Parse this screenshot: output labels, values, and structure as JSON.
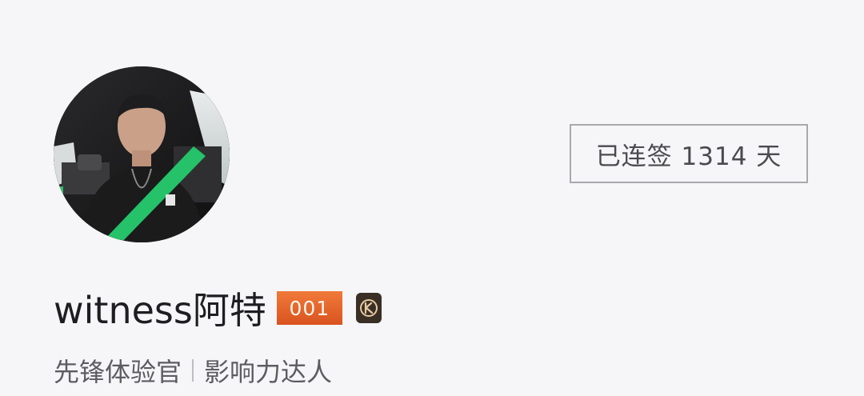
{
  "profile": {
    "username": "witness阿特",
    "level_badge": "001",
    "avatar_icon": "user-avatar-photo",
    "verify_icon": "k-verified-badge-icon",
    "colors": {
      "background": "#f6f6f8",
      "level_badge": "#e0602a",
      "verify_badge": "#3a2f25",
      "streak_border": "#a9a9ad"
    }
  },
  "streak": {
    "label": "已连签 1314 天"
  },
  "tags": [
    {
      "label": "先锋体验官"
    },
    {
      "label": "影响力达人"
    }
  ]
}
